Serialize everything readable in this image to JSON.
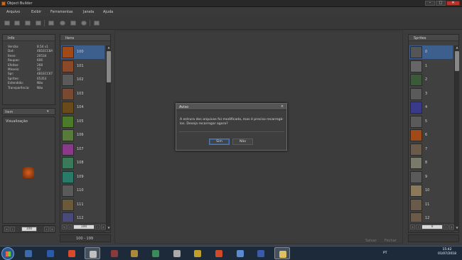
{
  "window": {
    "title": "Object Builder"
  },
  "menu": [
    "Arquivo",
    "Exibir",
    "Ferramentas",
    "Janela",
    "Ajuda"
  ],
  "info": {
    "title": "Info",
    "rows": [
      {
        "label": "Versão:",
        "value": "8.54 v1"
      },
      {
        "label": "Dat:",
        "value": "4B1ECC8A"
      },
      {
        "label": "Itens:",
        "value": "20534"
      },
      {
        "label": "Roupas:",
        "value": "606"
      },
      {
        "label": "Efeitos:",
        "value": "268"
      },
      {
        "label": "Mísseis:",
        "value": "52"
      },
      {
        "label": "Spr:",
        "value": "4B1ECC67"
      },
      {
        "label": "Sprites:",
        "value": "65353"
      },
      {
        "label": "Estendido:",
        "value": "Não"
      },
      {
        "label": "Transparência:",
        "value": "Não"
      }
    ]
  },
  "category_select": {
    "value": "Item"
  },
  "preview": {
    "title": "Visualização"
  },
  "items_panel": {
    "title": "Itens",
    "rows": [
      {
        "id": "100",
        "color": "#a04a18"
      },
      {
        "id": "101",
        "color": "#8a4a2a"
      },
      {
        "id": "102",
        "color": "#5a5a5a"
      },
      {
        "id": "103",
        "color": "#7a4a30"
      },
      {
        "id": "104",
        "color": "#6a4a1a"
      },
      {
        "id": "105",
        "color": "#4a7a2a"
      },
      {
        "id": "106",
        "color": "#5a7a3a"
      },
      {
        "id": "107",
        "color": "#8a3a8a"
      },
      {
        "id": "108",
        "color": "#3a7a5a"
      },
      {
        "id": "109",
        "color": "#2a7a6a"
      },
      {
        "id": "110",
        "color": "#5a5a5a"
      },
      {
        "id": "111",
        "color": "#6a5a3a"
      },
      {
        "id": "112",
        "color": "#4a4a7a"
      }
    ],
    "pager_value": "100",
    "range": "100 - 199"
  },
  "sprites_panel": {
    "title": "Sprites",
    "rows": [
      {
        "id": "0",
        "color": "#555"
      },
      {
        "id": "1",
        "color": "#666"
      },
      {
        "id": "2",
        "color": "#3a5a3a"
      },
      {
        "id": "3",
        "color": "#5a5a5a"
      },
      {
        "id": "4",
        "color": "#3a3a8a"
      },
      {
        "id": "5",
        "color": "#5a5a5a"
      },
      {
        "id": "6",
        "color": "#a04a18"
      },
      {
        "id": "7",
        "color": "#6a5a4a"
      },
      {
        "id": "8",
        "color": "#7a7a6a"
      },
      {
        "id": "9",
        "color": "#5a5a5a"
      },
      {
        "id": "10",
        "color": "#8a7a5a"
      },
      {
        "id": "11",
        "color": "#6a5a4a"
      },
      {
        "id": "12",
        "color": "#6a5a4a"
      }
    ],
    "pager_value": "0"
  },
  "footer": {
    "save": "Salvar",
    "close": "Fechar"
  },
  "dialog": {
    "title": "Aviso",
    "message": "A estrura dos arquivos foi modificada, mas é preciso recarregá-los. Deseja recarregar agora?",
    "yes": "Sim",
    "no": "Não"
  },
  "taskbar": {
    "apps": [
      {
        "name": "windows-explorer",
        "color": "#3a6aaa"
      },
      {
        "name": "word",
        "color": "#2a5aaa"
      },
      {
        "name": "chrome",
        "color": "#d84a2a"
      },
      {
        "name": "object-builder",
        "color": "#c0c0c0"
      },
      {
        "name": "app-5",
        "color": "#8a3a3a"
      },
      {
        "name": "app-6",
        "color": "#aa8a3a"
      },
      {
        "name": "app-7",
        "color": "#3a8a5a"
      },
      {
        "name": "app-8",
        "color": "#aaa"
      },
      {
        "name": "app-9",
        "color": "#c0a02a"
      },
      {
        "name": "app-10",
        "color": "#d04a2a"
      },
      {
        "name": "app-11",
        "color": "#5a8ad0"
      },
      {
        "name": "app-12",
        "color": "#3a5aaa"
      },
      {
        "name": "app-13",
        "color": "#e0c060"
      }
    ],
    "lang": "PT",
    "time": "15:42",
    "date": "01/07/2018"
  }
}
